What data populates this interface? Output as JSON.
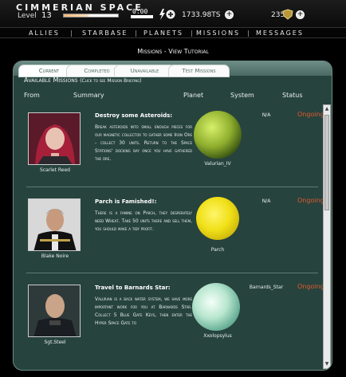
{
  "header": {
    "logo": "CIMMERIAN SPACE",
    "level_label": "Level",
    "level_value": "13",
    "xp_fraction": 0.45,
    "timer": "0:00",
    "credits": "1733.98TS",
    "points": "235"
  },
  "nav": [
    "ALLIES",
    "STARBASE",
    "PLANETS",
    "MISSIONS",
    "MESSAGES"
  ],
  "page": {
    "title": "Missions",
    "separator": " - ",
    "link": "View Tutorial"
  },
  "tabs": [
    "Current",
    "Completed",
    "Unavailable",
    "Test Missions"
  ],
  "available": {
    "label": "Available Missions",
    "hint": "(Click to see Mission Briefing)"
  },
  "columns": {
    "from": "From",
    "summary": "Summary",
    "planet": "Planet",
    "system": "System",
    "status": "Status"
  },
  "missions": [
    {
      "from": "Scarlet Reed",
      "title": "Destroy some Asteroids:",
      "description": "Break asteroids into small enough pieces for our magnetic collector to gather some Iron Ore - collect 30 units. Return to the Space Stations' docking bay once you have gathered the ore.",
      "planet": "Valurian_IV",
      "system": "N/A",
      "status": "Ongoing"
    },
    {
      "from": "Blake Noire",
      "title": "Parch is Famished!:",
      "description": "There is a famine on Parch, they desperately need Wheat. Take 50 units there and sell them, you should make a tidy profit.",
      "planet": "Parch",
      "system": "N/A",
      "status": "Ongoing"
    },
    {
      "from": "Sgt.Steel",
      "title": "Travel to Barnards Star:",
      "description": "Valurian is a back water system, we have more important work for you at Barnards Star. Collect 5 Blue Gate Keys, then enter the Hyper Space Gate to",
      "planet": "Xxolopsylus",
      "system": "Barnards_Star",
      "status": "Ongoing"
    }
  ],
  "colors": {
    "accent": "#e05a2c",
    "panel": "#27433e",
    "tab_bar": "#5b7a73"
  },
  "icons": [
    "energy-icon",
    "plus-icon",
    "shield-icon"
  ]
}
